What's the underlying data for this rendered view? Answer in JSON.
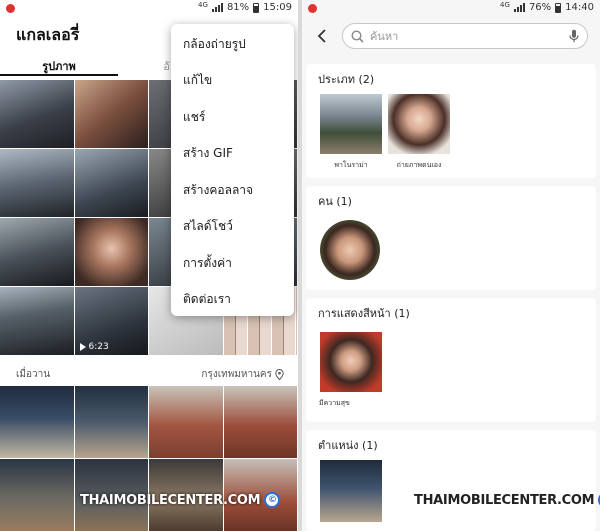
{
  "left": {
    "statusbar": {
      "network": "4G",
      "battery": "81%",
      "time": "15:09"
    },
    "title": "แกลเลอรี่",
    "tabs": [
      "รูปภาพ",
      "อัลบั้ม"
    ],
    "video_duration": "6:23",
    "section": {
      "label": "เมื่อวาน",
      "location": "กรุงเทพมหานคร"
    },
    "menu": [
      "กล้องถ่ายรูป",
      "แก้ไข",
      "แชร์",
      "สร้าง GIF",
      "สร้างคอลลาจ",
      "สไลด์โชว์",
      "การตั้งค่า",
      "ติดต่อเรา"
    ],
    "watermark": "THAIMOBILECENTER.COM"
  },
  "right": {
    "statusbar": {
      "network": "4G",
      "battery": "76%",
      "time": "14:40"
    },
    "search_placeholder": "ค้นหา",
    "sections": [
      {
        "title": "ประเภท (2)",
        "items": [
          "พาโนราม่า",
          "ถ่ายภาพตนเอง"
        ]
      },
      {
        "title": "คน (1)"
      },
      {
        "title": "การแสดงสีหน้า (1)",
        "items": [
          "มีความสุข"
        ]
      },
      {
        "title": "ตำแหน่ง (1)"
      }
    ],
    "watermark": "THAIMOBILECENTER.COM"
  },
  "colors": {
    "menu_bg": "#ffffff",
    "accent": "#2a6fd8",
    "app_icon": "#e0322f"
  }
}
